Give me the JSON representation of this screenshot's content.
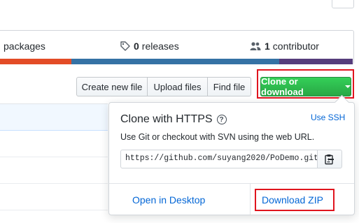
{
  "summary": {
    "packages_label": "packages",
    "releases_count": "0",
    "releases_label": "releases",
    "contributors_count": "1",
    "contributors_label": "contributor"
  },
  "language_bar": {
    "colors": [
      "#e34c26",
      "#3572a5",
      "#563d7c"
    ]
  },
  "toolbar": {
    "create_new_file": "Create new file",
    "upload_files": "Upload files",
    "find_file": "Find file",
    "clone_or_download": "Clone or download"
  },
  "clone_panel": {
    "title": "Clone with HTTPS",
    "help_glyph": "?",
    "use_ssh": "Use SSH",
    "description": "Use Git or checkout with SVN using the web URL.",
    "url": "https://github.com/suyang2020/PoDemo.git",
    "open_in_desktop": "Open in Desktop",
    "download_zip": "Download ZIP"
  },
  "colors": {
    "accent_green": "#28a745",
    "link_blue": "#0366d6",
    "highlight_red": "#e0141e"
  }
}
